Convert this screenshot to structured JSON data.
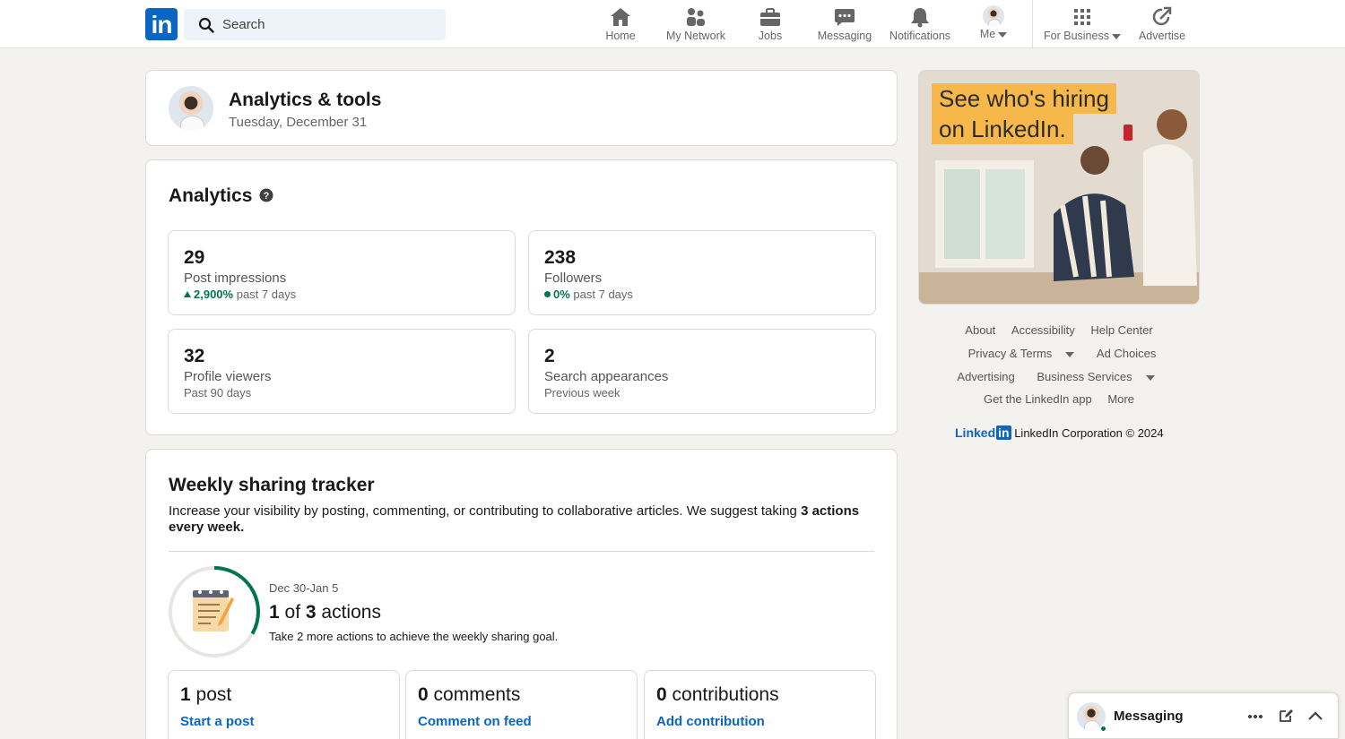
{
  "nav": {
    "search_placeholder": "Search",
    "items": [
      {
        "label": "Home"
      },
      {
        "label": "My Network"
      },
      {
        "label": "Jobs"
      },
      {
        "label": "Messaging"
      },
      {
        "label": "Notifications"
      },
      {
        "label": "Me"
      },
      {
        "label": "For Business"
      },
      {
        "label": "Advertise"
      }
    ]
  },
  "header_card": {
    "title": "Analytics & tools",
    "date": "Tuesday, December 31"
  },
  "analytics": {
    "title": "Analytics",
    "stats": [
      {
        "value": "29",
        "label": "Post impressions",
        "change": "2,900%",
        "period": "past 7 days"
      },
      {
        "value": "238",
        "label": "Followers",
        "change": "0%",
        "period": "past 7 days"
      },
      {
        "value": "32",
        "label": "Profile viewers",
        "period": "Past 90 days"
      },
      {
        "value": "2",
        "label": "Search appearances",
        "period": "Previous week"
      }
    ]
  },
  "tracker": {
    "title": "Weekly sharing tracker",
    "desc": "Increase your visibility by posting, commenting, or contributing to collaborative articles. We suggest taking ",
    "desc_bold": "3 actions every week.",
    "range": "Dec 30-Jan 5",
    "done": "1",
    "of": "of",
    "goal": "3",
    "unit": "actions",
    "progress": 0.333,
    "note": "Take 2 more actions to achieve the weekly sharing goal.",
    "actions": [
      {
        "count": "1",
        "label": "post",
        "link": "Start a post"
      },
      {
        "count": "0",
        "label": "comments",
        "link": "Comment on feed"
      },
      {
        "count": "0",
        "label": "contributions",
        "link": "Add contribution"
      }
    ]
  },
  "ad": {
    "line1": "See who's hiring",
    "line2": "on LinkedIn."
  },
  "footer": {
    "row1": [
      "About",
      "Accessibility",
      "Help Center"
    ],
    "row2": [
      "Privacy & Terms",
      "Ad Choices"
    ],
    "row3": [
      "Advertising",
      "Business Services"
    ],
    "row4": [
      "Get the LinkedIn app",
      "More"
    ],
    "brand": "Linked",
    "brand_in": "in",
    "copyright": "LinkedIn Corporation © 2024"
  },
  "messaging_dock": {
    "title": "Messaging"
  },
  "colors": {
    "brand": "#0a66c2",
    "positive": "#01754f",
    "ad_accent": "#f6b84a"
  },
  "icons": [
    "linkedin-logo",
    "search-icon",
    "home-icon",
    "network-icon",
    "jobs-icon",
    "messaging-icon",
    "bell-icon",
    "apps-grid-icon",
    "advertise-icon",
    "help-icon",
    "notepad-icon",
    "more-icon",
    "compose-icon",
    "chevron-up-icon"
  ]
}
